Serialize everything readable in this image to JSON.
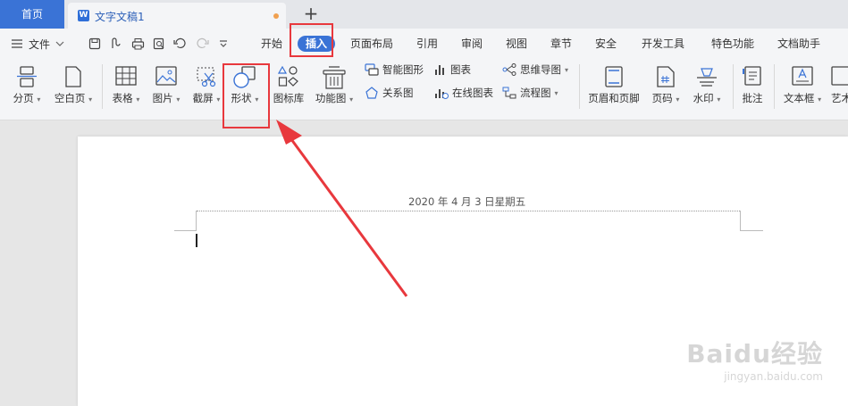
{
  "tabbar": {
    "home": "首页",
    "doc_title": "文字文稿1",
    "doc_icon": "W",
    "new_tab": "+"
  },
  "menu": {
    "file": "文件",
    "tabs": [
      "开始",
      "插入",
      "页面布局",
      "引用",
      "审阅",
      "视图",
      "章节",
      "安全",
      "开发工具",
      "特色功能",
      "文档助手"
    ],
    "active_tab": "插入"
  },
  "toolbar": {
    "page_break": "分页",
    "blank_page": "空白页",
    "table": "表格",
    "picture": "图片",
    "screenshot": "截屏",
    "shape": "形状",
    "icon_library": "图标库",
    "function_chart": "功能图",
    "smart_graphic": "智能图形",
    "chart": "图表",
    "mind_map": "思维导图",
    "relation_chart": "关系图",
    "online_chart": "在线图表",
    "flowchart": "流程图",
    "header_footer": "页眉和页脚",
    "page_number": "页码",
    "watermark": "水印",
    "comment": "批注",
    "text_box": "文本框",
    "art_text": "艺术"
  },
  "document": {
    "header_text": "2020 年 4 月 3 日星期五"
  },
  "watermark": {
    "line1": "Baidu经验",
    "line2": "jingyan.baidu.com"
  },
  "colors": {
    "accent": "#3a73d6",
    "highlight": "#e8383d"
  }
}
